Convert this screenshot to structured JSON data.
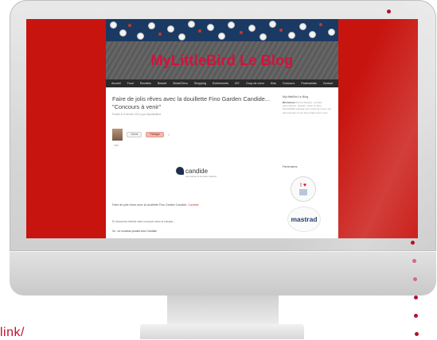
{
  "blog": {
    "title": "MyLittleBird Le Blog",
    "nav": [
      "Accueil",
      "Food",
      "Recettes",
      "Beauté",
      "Mode/Déco",
      "Shopping",
      "Evénements",
      "DIY",
      "Coup de cœur",
      "Kids",
      "Concours",
      "Partenariats",
      "Contact"
    ]
  },
  "post": {
    "title": "Faire de jolis rêves avec la douillette Fino Garden Candide... \"Concours à venir\"",
    "meta": "Publié le 5 février 2014 par MyLittleBird",
    "share_like": "J'aime",
    "share_fb": "Partager",
    "share_count": "0",
    "small_link": "Lire...",
    "logo_text": "candide",
    "logo_sub": "une marque de la maison Valentin",
    "body": "Faire de jolis rêves avec la douillette Fino Garden Candide.",
    "body_link": "Candide",
    "body2": "Et découvrez bientôt notre concours avec la marque...",
    "body3": "Vu : un nouveau produit chez Candide"
  },
  "sidebar": {
    "heading": "MyLittleBird Le Blog",
    "text": "Entre lifestyle, recettes gourmandes, beauté, mode et déco, MyLittleBird partage ses coups de cœur, ses découvertes et ses bons plans avec vous.",
    "highlight": "Bienvenue !",
    "heading2": "Partenaires",
    "badge_heart": "I ♥",
    "mastrad": "mastrad"
  },
  "url_fragment": "link/"
}
